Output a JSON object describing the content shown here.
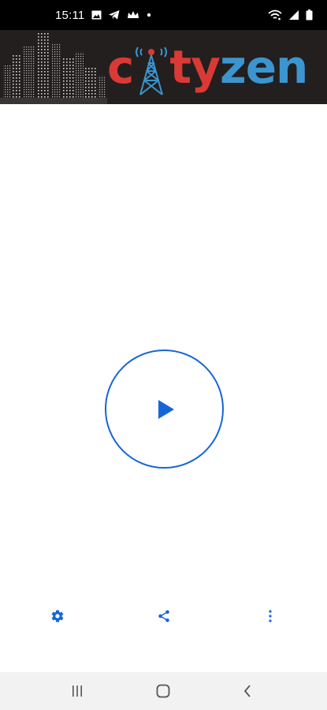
{
  "status_bar": {
    "time": "15:11",
    "left_icons": [
      "gallery-icon",
      "telegram-icon",
      "crown-icon",
      "dot-icon"
    ],
    "right_icons": [
      "wifi-icon",
      "signal-icon",
      "battery-icon"
    ]
  },
  "banner": {
    "logo_text_red_1": "c",
    "logo_text_red_2": "ty",
    "logo_text_blue": "zen",
    "colors": {
      "red": "#d93a35",
      "blue": "#3b95cf",
      "background": "#231f1f"
    }
  },
  "player": {
    "play_icon": "play-icon",
    "accent": "#1565d8"
  },
  "actions": {
    "settings_icon": "gear-icon",
    "share_icon": "share-icon",
    "more_icon": "more-vertical-icon"
  },
  "nav": {
    "recents_icon": "recents-icon",
    "home_icon": "home-icon",
    "back_icon": "back-icon"
  }
}
